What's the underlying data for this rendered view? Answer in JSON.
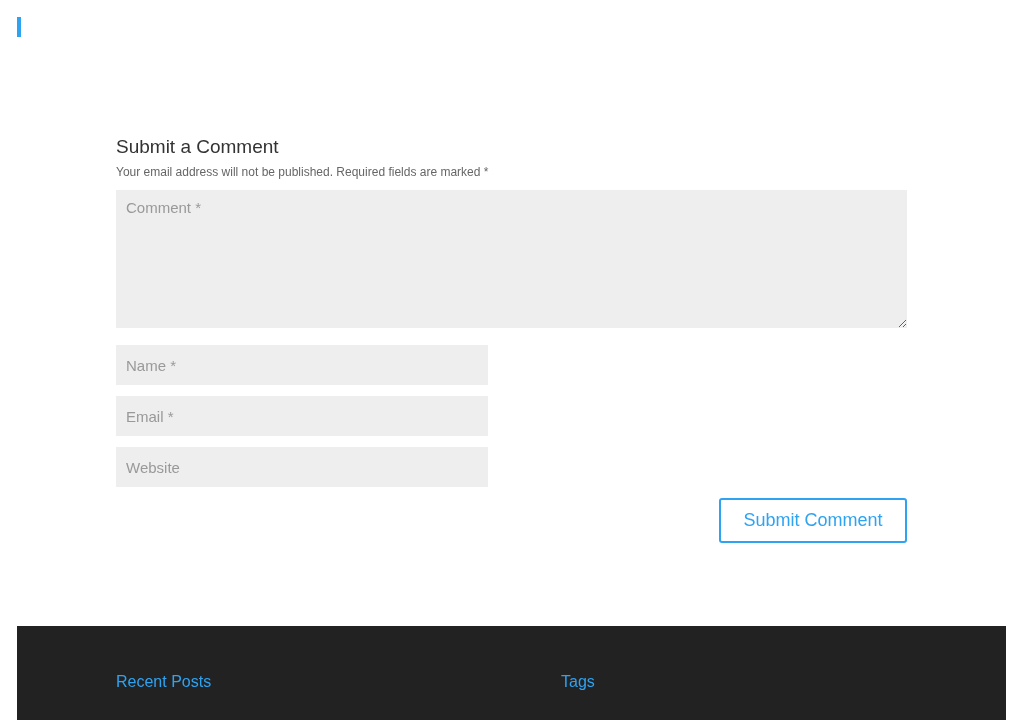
{
  "comment_form": {
    "title": "Submit a Comment",
    "notice": "Your email address will not be published. Required fields are marked *",
    "fields": [
      {
        "kind": "textarea",
        "placeholder": "Comment *"
      },
      {
        "kind": "text",
        "placeholder": "Name *"
      },
      {
        "kind": "text",
        "placeholder": "Email *"
      },
      {
        "kind": "text",
        "placeholder": "Website"
      }
    ],
    "submit_button": "Submit Comment"
  },
  "footer": {
    "widgets": [
      {
        "title": "Recent Posts"
      },
      {
        "title": "Tags"
      }
    ]
  }
}
